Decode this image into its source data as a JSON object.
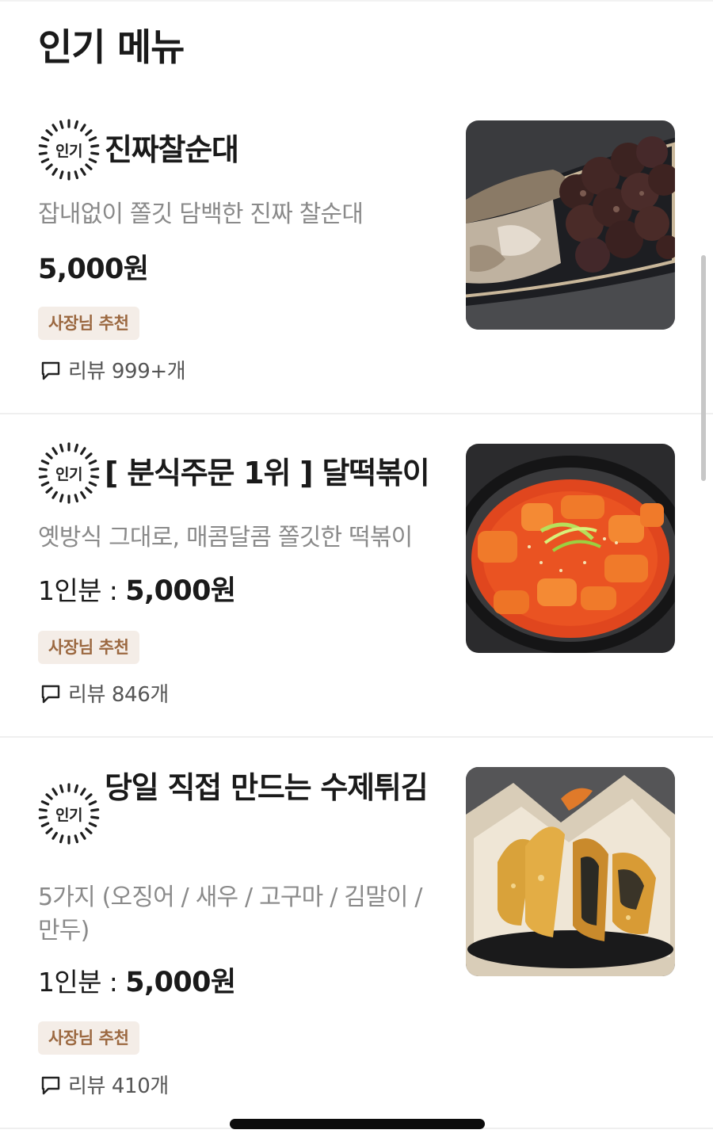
{
  "section": {
    "title": "인기 메뉴"
  },
  "popular_badge_label": "인기",
  "owner_badge_label": "사장님 추천",
  "colors": {
    "owner_badge_bg": "#f4ede7",
    "owner_badge_text": "#9b6840",
    "desc_text": "#8a8a8a"
  },
  "items": [
    {
      "name": "진짜찰순대",
      "description": "잡내없이 쫄깃 담백한 진짜 찰순대",
      "price_prefix": "",
      "price": "5,000원",
      "review": "리뷰 999+개",
      "image": "sundae-photo"
    },
    {
      "name": "[ 분식주문 1위 ] 달떡볶이",
      "description": "옛방식 그대로, 매콤달콤 쫄깃한 떡볶이",
      "price_prefix": "1인분 : ",
      "price": "5,000원",
      "review": "리뷰 846개",
      "image": "tteokbokki-photo"
    },
    {
      "name": "당일 직접 만드는 수제튀김",
      "description": "5가지 (오징어 / 새우 / 고구마 / 김말이 / 만두)",
      "price_prefix": "1인분 : ",
      "price": "5,000원",
      "review": "리뷰 410개",
      "image": "fried-food-photo"
    }
  ],
  "icons": {
    "review": "speech-bubble-icon",
    "popular": "sunburst-badge-icon"
  }
}
